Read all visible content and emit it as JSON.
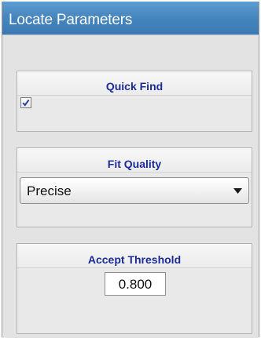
{
  "panel": {
    "title": "Locate Parameters"
  },
  "quick_find": {
    "title": "Quick Find",
    "checked": true
  },
  "fit_quality": {
    "title": "Fit Quality",
    "selected": "Precise"
  },
  "accept_threshold": {
    "title": "Accept Threshold",
    "value": "0.800"
  },
  "icons": {
    "checkbox_check": "check-icon",
    "dropdown_arrow": "chevron-down-icon"
  },
  "colors": {
    "header": "#4585bd",
    "group_title": "#1c2c96",
    "check": "#2b3fa6"
  }
}
